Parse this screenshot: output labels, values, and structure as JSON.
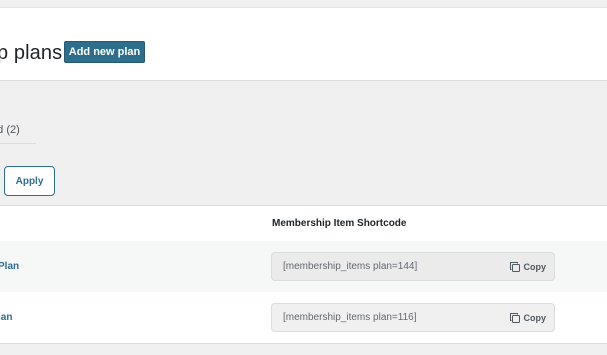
{
  "header": {
    "title": "p plans",
    "add_button_label": "Add new plan"
  },
  "filters": {
    "label": "ed",
    "count": "(2)"
  },
  "apply_button_label": "Apply",
  "table": {
    "columns": {
      "shortcode": "Membership Item Shortcode"
    },
    "rows": [
      {
        "name": "Plan",
        "shortcode": "[membership_items plan=144]",
        "copy_label": "Copy"
      },
      {
        "name": "lan",
        "shortcode": "[membership_items plan=116]",
        "copy_label": "Copy"
      }
    ]
  },
  "icons": {
    "copy": "copy-icon"
  },
  "colors": {
    "accent": "#2d6e8c",
    "background": "#f0f0f1"
  }
}
